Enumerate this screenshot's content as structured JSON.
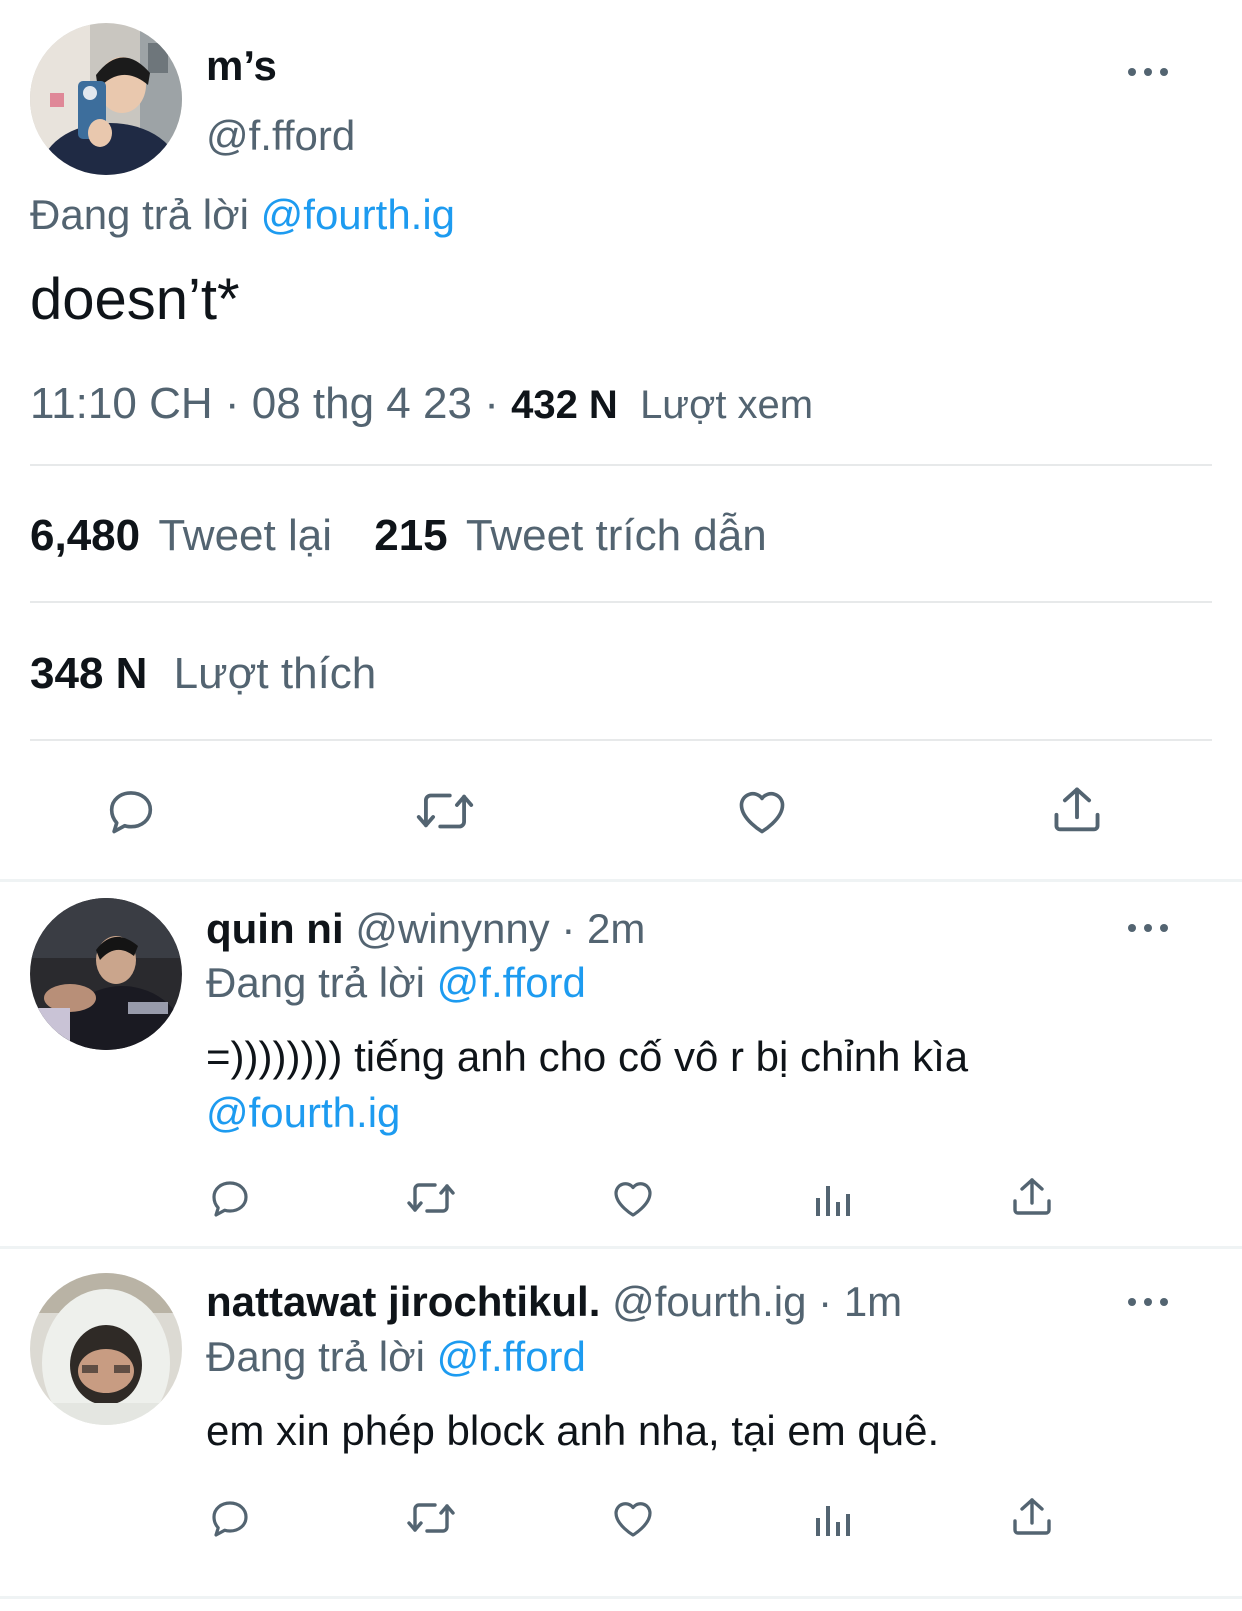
{
  "main_tweet": {
    "display_name": "m’s",
    "handle": "@f.fford",
    "replying_prefix": "Đang trả lời",
    "replying_to": "@fourth.ig",
    "text": "doesn’t*",
    "time": "11:10 CH",
    "date": "08 thg 4 23",
    "sep": "·",
    "views_count": "432 N",
    "views_label": "Lượt xem",
    "retweets_count": "6,480",
    "retweets_label": "Tweet lại",
    "quotes_count": "215",
    "quotes_label": "Tweet trích dẫn",
    "likes_count": "348 N",
    "likes_label": "Lượt thích"
  },
  "replies": [
    {
      "display_name": "quin ni",
      "handle": "@winynny",
      "sep": "·",
      "age": "2m",
      "replying_prefix": "Đang trả lời",
      "replying_to": "@f.fford",
      "text": "=)))))))) tiếng anh cho cố vô r bị chỉnh kìa",
      "mention": "@fourth.ig"
    },
    {
      "display_name": "nattawat jirochtikul.",
      "handle": "@fourth.ig",
      "sep": "·",
      "age": "1m",
      "replying_prefix": "Đang trả lời",
      "replying_to": "@f.fford",
      "text": "em xin phép block anh nha, tại em quê."
    }
  ],
  "icons": {
    "reply": "reply-icon",
    "retweet": "retweet-icon",
    "like": "heart-icon",
    "views": "views-icon",
    "share": "share-icon",
    "more": "more-icon"
  },
  "colors": {
    "accent": "#1d9bf0",
    "secondary_text": "#536471",
    "primary_text": "#0f1419",
    "divider": "#e7e9ea"
  }
}
